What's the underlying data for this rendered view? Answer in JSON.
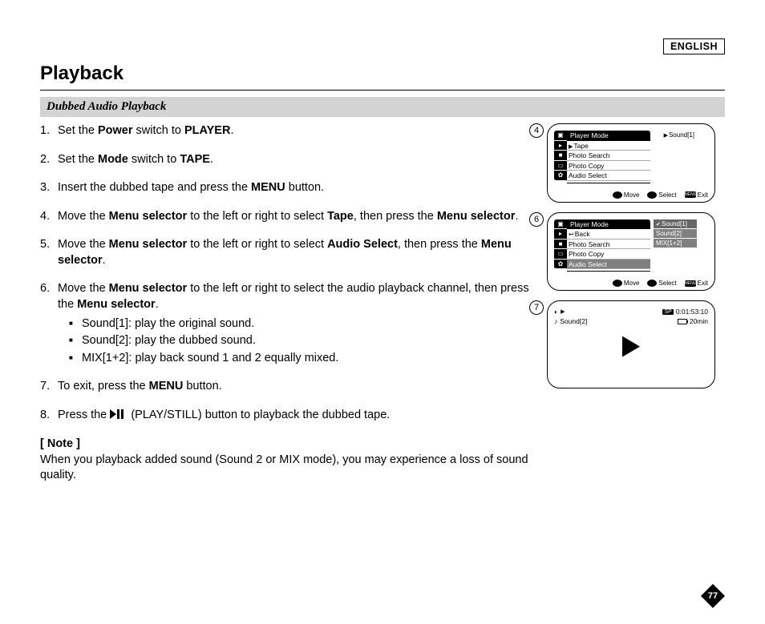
{
  "language_badge": "ENGLISH",
  "page_title": "Playback",
  "section_title": "Dubbed Audio Playback",
  "steps": {
    "s1": {
      "num": "1.",
      "pre": "Set the ",
      "b1": "Power",
      "mid": " switch to ",
      "b2": "PLAYER",
      "post": "."
    },
    "s2": {
      "num": "2.",
      "pre": "Set the ",
      "b1": "Mode",
      "mid": " switch to ",
      "b2": "TAPE",
      "post": "."
    },
    "s3": {
      "num": "3.",
      "pre": "Insert the dubbed tape and press the ",
      "b1": "MENU",
      "post": " button."
    },
    "s4": {
      "num": "4.",
      "pre": "Move the ",
      "b1": "Menu selector",
      "mid": " to the left or right to select ",
      "b2": "Tape",
      "mid2": ", then press the ",
      "b3": "Menu selector",
      "post": "."
    },
    "s5": {
      "num": "5.",
      "pre": "Move the ",
      "b1": "Menu selector",
      "mid": " to the left or right to select ",
      "b2": "Audio Select",
      "mid2": ", then press the ",
      "b3": "Menu selector",
      "post": "."
    },
    "s6": {
      "num": "6.",
      "pre": "Move the ",
      "b1": "Menu selector",
      "mid": " to the left or right to select the audio playback channel, then press the ",
      "b2": "Menu selector",
      "post": ".",
      "bullets": {
        "a": "Sound[1]: play the original sound.",
        "b": "Sound[2]: play the dubbed sound.",
        "c": "MIX[1+2]: play back sound 1 and 2 equally mixed."
      }
    },
    "s7": {
      "num": "7.",
      "pre": "To exit, press the ",
      "b1": "MENU",
      "post": " button."
    },
    "s8": {
      "num": "8.",
      "pre": "Press the ",
      "post_icon": "(PLAY/STILL) button to playback the dubbed tape."
    }
  },
  "note": {
    "title": "[ Note ]",
    "body": "When you playback added sound (Sound 2 or MIX mode), you may experience a loss of sound quality."
  },
  "screens": {
    "s4": {
      "badge": "4",
      "header": "Player Mode",
      "items": {
        "tape": "Tape",
        "photo_search": "Photo Search",
        "photo_copy": "Photo Copy",
        "audio_select": "Audio Select"
      },
      "side_value": "Sound[1]",
      "hints": {
        "move": "Move",
        "select": "Select",
        "menu": "MENU",
        "exit": "Exit"
      }
    },
    "s6": {
      "badge": "6",
      "header": "Player Mode",
      "items": {
        "back": "Back",
        "photo_search": "Photo Search",
        "photo_copy": "Photo Copy",
        "audio_select": "Audio Select"
      },
      "sub_items": {
        "a": "Sound[1]",
        "b": "Sound[2]",
        "c": "MIX[1+2]"
      },
      "hints": {
        "move": "Move",
        "select": "Select",
        "menu": "MENU",
        "exit": "Exit"
      }
    },
    "s7": {
      "badge": "7",
      "sound_label": "Sound[2]",
      "sp": "SP",
      "timecode": "0:01:53:10",
      "remain": "20min"
    }
  },
  "page_number": "77"
}
